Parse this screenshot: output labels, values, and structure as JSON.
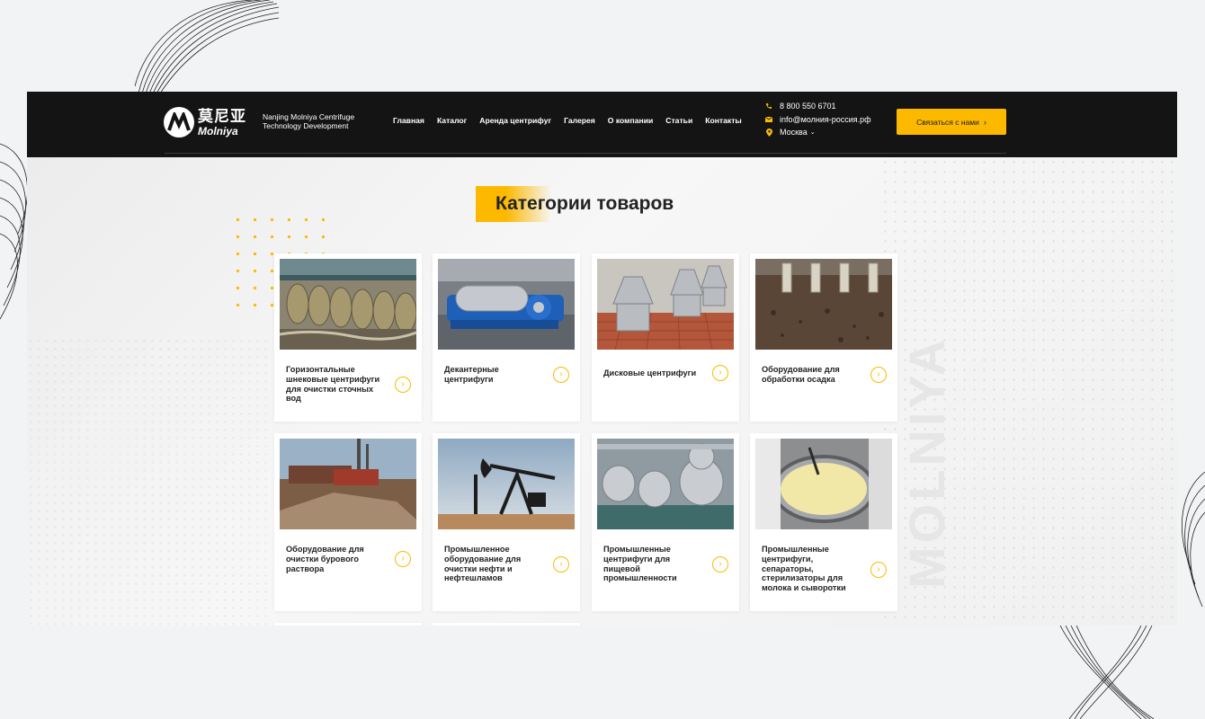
{
  "header": {
    "logo": {
      "cn": "莫尼亚",
      "en": "Molniya"
    },
    "company_line1": "Nanjing Molniya Centrifuge",
    "company_line2": "Technology Development",
    "nav": [
      "Главная",
      "Каталог",
      "Аренда центрифуг",
      "Галерея",
      "О компании",
      "Статьи",
      "Контакты"
    ],
    "contacts": {
      "phone": "8 800 550 6701",
      "email": "info@молния-россия.рф",
      "city": "Москва"
    },
    "cta_label": "Связаться с нами"
  },
  "main": {
    "title": "Категории товаров",
    "watermark": "MOLNIYA",
    "categories": [
      {
        "label": "Горизонтальные шнековые центрифуги для очистки сточных вод",
        "image": "wastewater-treatment-photo"
      },
      {
        "label": "Декантерные центрифуги",
        "image": "decanter-centrifuge-photo"
      },
      {
        "label": "Дисковые центрифуги",
        "image": "disc-centrifuge-photo"
      },
      {
        "label": "Оборудование для обработки осадка",
        "image": "sludge-processing-photo"
      },
      {
        "label": "Оборудование для очистки бурового раствора",
        "image": "drilling-mud-site-photo"
      },
      {
        "label": "Промышленное оборудование для очистки нефти и нефтешламов",
        "image": "oil-pump-jack-photo"
      },
      {
        "label": "Промышленные центрифуги для пищевой промышленности",
        "image": "food-industry-kettles-photo"
      },
      {
        "label": "Промышленные центрифуги, сепараторы, стерилизаторы для молока и сыворотки",
        "image": "milk-vat-photo"
      }
    ]
  },
  "colors": {
    "accent": "#fcb900",
    "header_bg": "#141414",
    "page_bg": "#f2f3f5"
  }
}
